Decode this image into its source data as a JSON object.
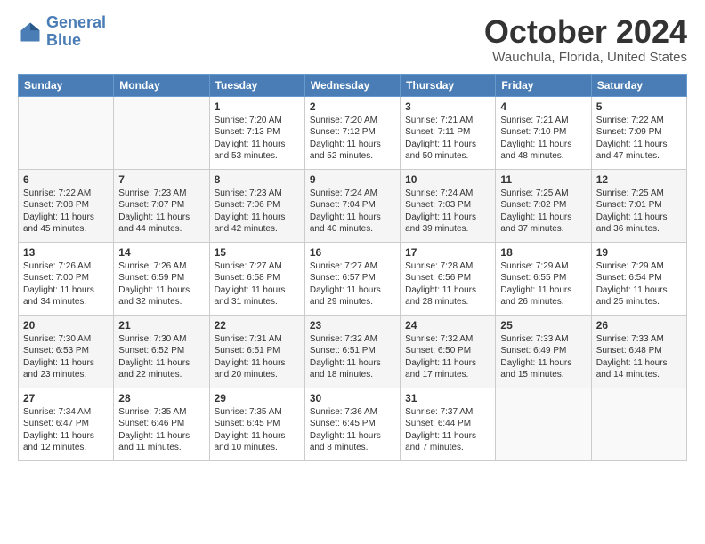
{
  "logo": {
    "line1": "General",
    "line2": "Blue"
  },
  "title": "October 2024",
  "location": "Wauchula, Florida, United States",
  "days_of_week": [
    "Sunday",
    "Monday",
    "Tuesday",
    "Wednesday",
    "Thursday",
    "Friday",
    "Saturday"
  ],
  "weeks": [
    [
      {
        "day": "",
        "sunrise": "",
        "sunset": "",
        "daylight": ""
      },
      {
        "day": "",
        "sunrise": "",
        "sunset": "",
        "daylight": ""
      },
      {
        "day": "1",
        "sunrise": "Sunrise: 7:20 AM",
        "sunset": "Sunset: 7:13 PM",
        "daylight": "Daylight: 11 hours and 53 minutes."
      },
      {
        "day": "2",
        "sunrise": "Sunrise: 7:20 AM",
        "sunset": "Sunset: 7:12 PM",
        "daylight": "Daylight: 11 hours and 52 minutes."
      },
      {
        "day": "3",
        "sunrise": "Sunrise: 7:21 AM",
        "sunset": "Sunset: 7:11 PM",
        "daylight": "Daylight: 11 hours and 50 minutes."
      },
      {
        "day": "4",
        "sunrise": "Sunrise: 7:21 AM",
        "sunset": "Sunset: 7:10 PM",
        "daylight": "Daylight: 11 hours and 48 minutes."
      },
      {
        "day": "5",
        "sunrise": "Sunrise: 7:22 AM",
        "sunset": "Sunset: 7:09 PM",
        "daylight": "Daylight: 11 hours and 47 minutes."
      }
    ],
    [
      {
        "day": "6",
        "sunrise": "Sunrise: 7:22 AM",
        "sunset": "Sunset: 7:08 PM",
        "daylight": "Daylight: 11 hours and 45 minutes."
      },
      {
        "day": "7",
        "sunrise": "Sunrise: 7:23 AM",
        "sunset": "Sunset: 7:07 PM",
        "daylight": "Daylight: 11 hours and 44 minutes."
      },
      {
        "day": "8",
        "sunrise": "Sunrise: 7:23 AM",
        "sunset": "Sunset: 7:06 PM",
        "daylight": "Daylight: 11 hours and 42 minutes."
      },
      {
        "day": "9",
        "sunrise": "Sunrise: 7:24 AM",
        "sunset": "Sunset: 7:04 PM",
        "daylight": "Daylight: 11 hours and 40 minutes."
      },
      {
        "day": "10",
        "sunrise": "Sunrise: 7:24 AM",
        "sunset": "Sunset: 7:03 PM",
        "daylight": "Daylight: 11 hours and 39 minutes."
      },
      {
        "day": "11",
        "sunrise": "Sunrise: 7:25 AM",
        "sunset": "Sunset: 7:02 PM",
        "daylight": "Daylight: 11 hours and 37 minutes."
      },
      {
        "day": "12",
        "sunrise": "Sunrise: 7:25 AM",
        "sunset": "Sunset: 7:01 PM",
        "daylight": "Daylight: 11 hours and 36 minutes."
      }
    ],
    [
      {
        "day": "13",
        "sunrise": "Sunrise: 7:26 AM",
        "sunset": "Sunset: 7:00 PM",
        "daylight": "Daylight: 11 hours and 34 minutes."
      },
      {
        "day": "14",
        "sunrise": "Sunrise: 7:26 AM",
        "sunset": "Sunset: 6:59 PM",
        "daylight": "Daylight: 11 hours and 32 minutes."
      },
      {
        "day": "15",
        "sunrise": "Sunrise: 7:27 AM",
        "sunset": "Sunset: 6:58 PM",
        "daylight": "Daylight: 11 hours and 31 minutes."
      },
      {
        "day": "16",
        "sunrise": "Sunrise: 7:27 AM",
        "sunset": "Sunset: 6:57 PM",
        "daylight": "Daylight: 11 hours and 29 minutes."
      },
      {
        "day": "17",
        "sunrise": "Sunrise: 7:28 AM",
        "sunset": "Sunset: 6:56 PM",
        "daylight": "Daylight: 11 hours and 28 minutes."
      },
      {
        "day": "18",
        "sunrise": "Sunrise: 7:29 AM",
        "sunset": "Sunset: 6:55 PM",
        "daylight": "Daylight: 11 hours and 26 minutes."
      },
      {
        "day": "19",
        "sunrise": "Sunrise: 7:29 AM",
        "sunset": "Sunset: 6:54 PM",
        "daylight": "Daylight: 11 hours and 25 minutes."
      }
    ],
    [
      {
        "day": "20",
        "sunrise": "Sunrise: 7:30 AM",
        "sunset": "Sunset: 6:53 PM",
        "daylight": "Daylight: 11 hours and 23 minutes."
      },
      {
        "day": "21",
        "sunrise": "Sunrise: 7:30 AM",
        "sunset": "Sunset: 6:52 PM",
        "daylight": "Daylight: 11 hours and 22 minutes."
      },
      {
        "day": "22",
        "sunrise": "Sunrise: 7:31 AM",
        "sunset": "Sunset: 6:51 PM",
        "daylight": "Daylight: 11 hours and 20 minutes."
      },
      {
        "day": "23",
        "sunrise": "Sunrise: 7:32 AM",
        "sunset": "Sunset: 6:51 PM",
        "daylight": "Daylight: 11 hours and 18 minutes."
      },
      {
        "day": "24",
        "sunrise": "Sunrise: 7:32 AM",
        "sunset": "Sunset: 6:50 PM",
        "daylight": "Daylight: 11 hours and 17 minutes."
      },
      {
        "day": "25",
        "sunrise": "Sunrise: 7:33 AM",
        "sunset": "Sunset: 6:49 PM",
        "daylight": "Daylight: 11 hours and 15 minutes."
      },
      {
        "day": "26",
        "sunrise": "Sunrise: 7:33 AM",
        "sunset": "Sunset: 6:48 PM",
        "daylight": "Daylight: 11 hours and 14 minutes."
      }
    ],
    [
      {
        "day": "27",
        "sunrise": "Sunrise: 7:34 AM",
        "sunset": "Sunset: 6:47 PM",
        "daylight": "Daylight: 11 hours and 12 minutes."
      },
      {
        "day": "28",
        "sunrise": "Sunrise: 7:35 AM",
        "sunset": "Sunset: 6:46 PM",
        "daylight": "Daylight: 11 hours and 11 minutes."
      },
      {
        "day": "29",
        "sunrise": "Sunrise: 7:35 AM",
        "sunset": "Sunset: 6:45 PM",
        "daylight": "Daylight: 11 hours and 10 minutes."
      },
      {
        "day": "30",
        "sunrise": "Sunrise: 7:36 AM",
        "sunset": "Sunset: 6:45 PM",
        "daylight": "Daylight: 11 hours and 8 minutes."
      },
      {
        "day": "31",
        "sunrise": "Sunrise: 7:37 AM",
        "sunset": "Sunset: 6:44 PM",
        "daylight": "Daylight: 11 hours and 7 minutes."
      },
      {
        "day": "",
        "sunrise": "",
        "sunset": "",
        "daylight": ""
      },
      {
        "day": "",
        "sunrise": "",
        "sunset": "",
        "daylight": ""
      }
    ]
  ]
}
